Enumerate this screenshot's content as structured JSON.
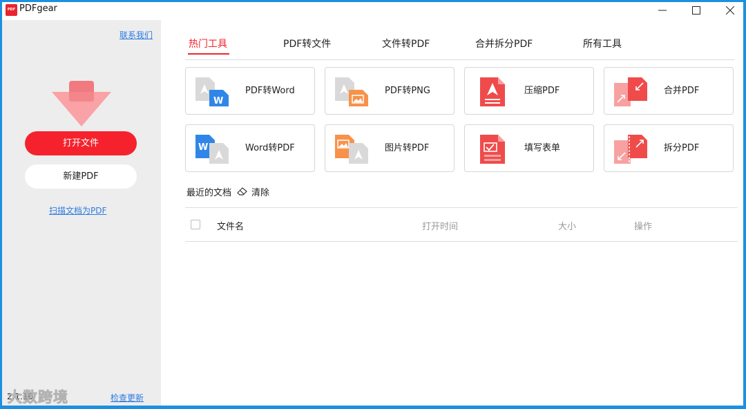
{
  "app": {
    "title": "PDFgear",
    "logo_text": "PDF"
  },
  "sidebar": {
    "contact_label": "联系我们",
    "open_file_label": "打开文件",
    "new_pdf_label": "新建PDF",
    "scan_label": "扫描文档为PDF",
    "version": "2.1.10",
    "check_update_label": "检查更新",
    "watermark": "大数跨境"
  },
  "tabs": [
    {
      "label": "热门工具",
      "active": true
    },
    {
      "label": "PDF转文件",
      "active": false
    },
    {
      "label": "文件转PDF",
      "active": false
    },
    {
      "label": "合并拆分PDF",
      "active": false
    },
    {
      "label": "所有工具",
      "active": false
    }
  ],
  "tools": [
    {
      "label": "PDF转Word",
      "icon": "pdf-to-word-icon"
    },
    {
      "label": "PDF转PNG",
      "icon": "pdf-to-png-icon"
    },
    {
      "label": "压缩PDF",
      "icon": "compress-pdf-icon"
    },
    {
      "label": "合并PDF",
      "icon": "merge-pdf-icon"
    },
    {
      "label": "Word转PDF",
      "icon": "word-to-pdf-icon"
    },
    {
      "label": "图片转PDF",
      "icon": "image-to-pdf-icon"
    },
    {
      "label": "填写表单",
      "icon": "fill-form-icon"
    },
    {
      "label": "拆分PDF",
      "icon": "split-pdf-icon"
    }
  ],
  "recent": {
    "title": "最近的文档",
    "clear_label": "清除",
    "columns": {
      "name": "文件名",
      "open_time": "打开时间",
      "size": "大小",
      "action": "操作"
    }
  },
  "colors": {
    "accent": "#f5222d",
    "link": "#2d7be0",
    "sidebar_bg": "#ededed"
  }
}
